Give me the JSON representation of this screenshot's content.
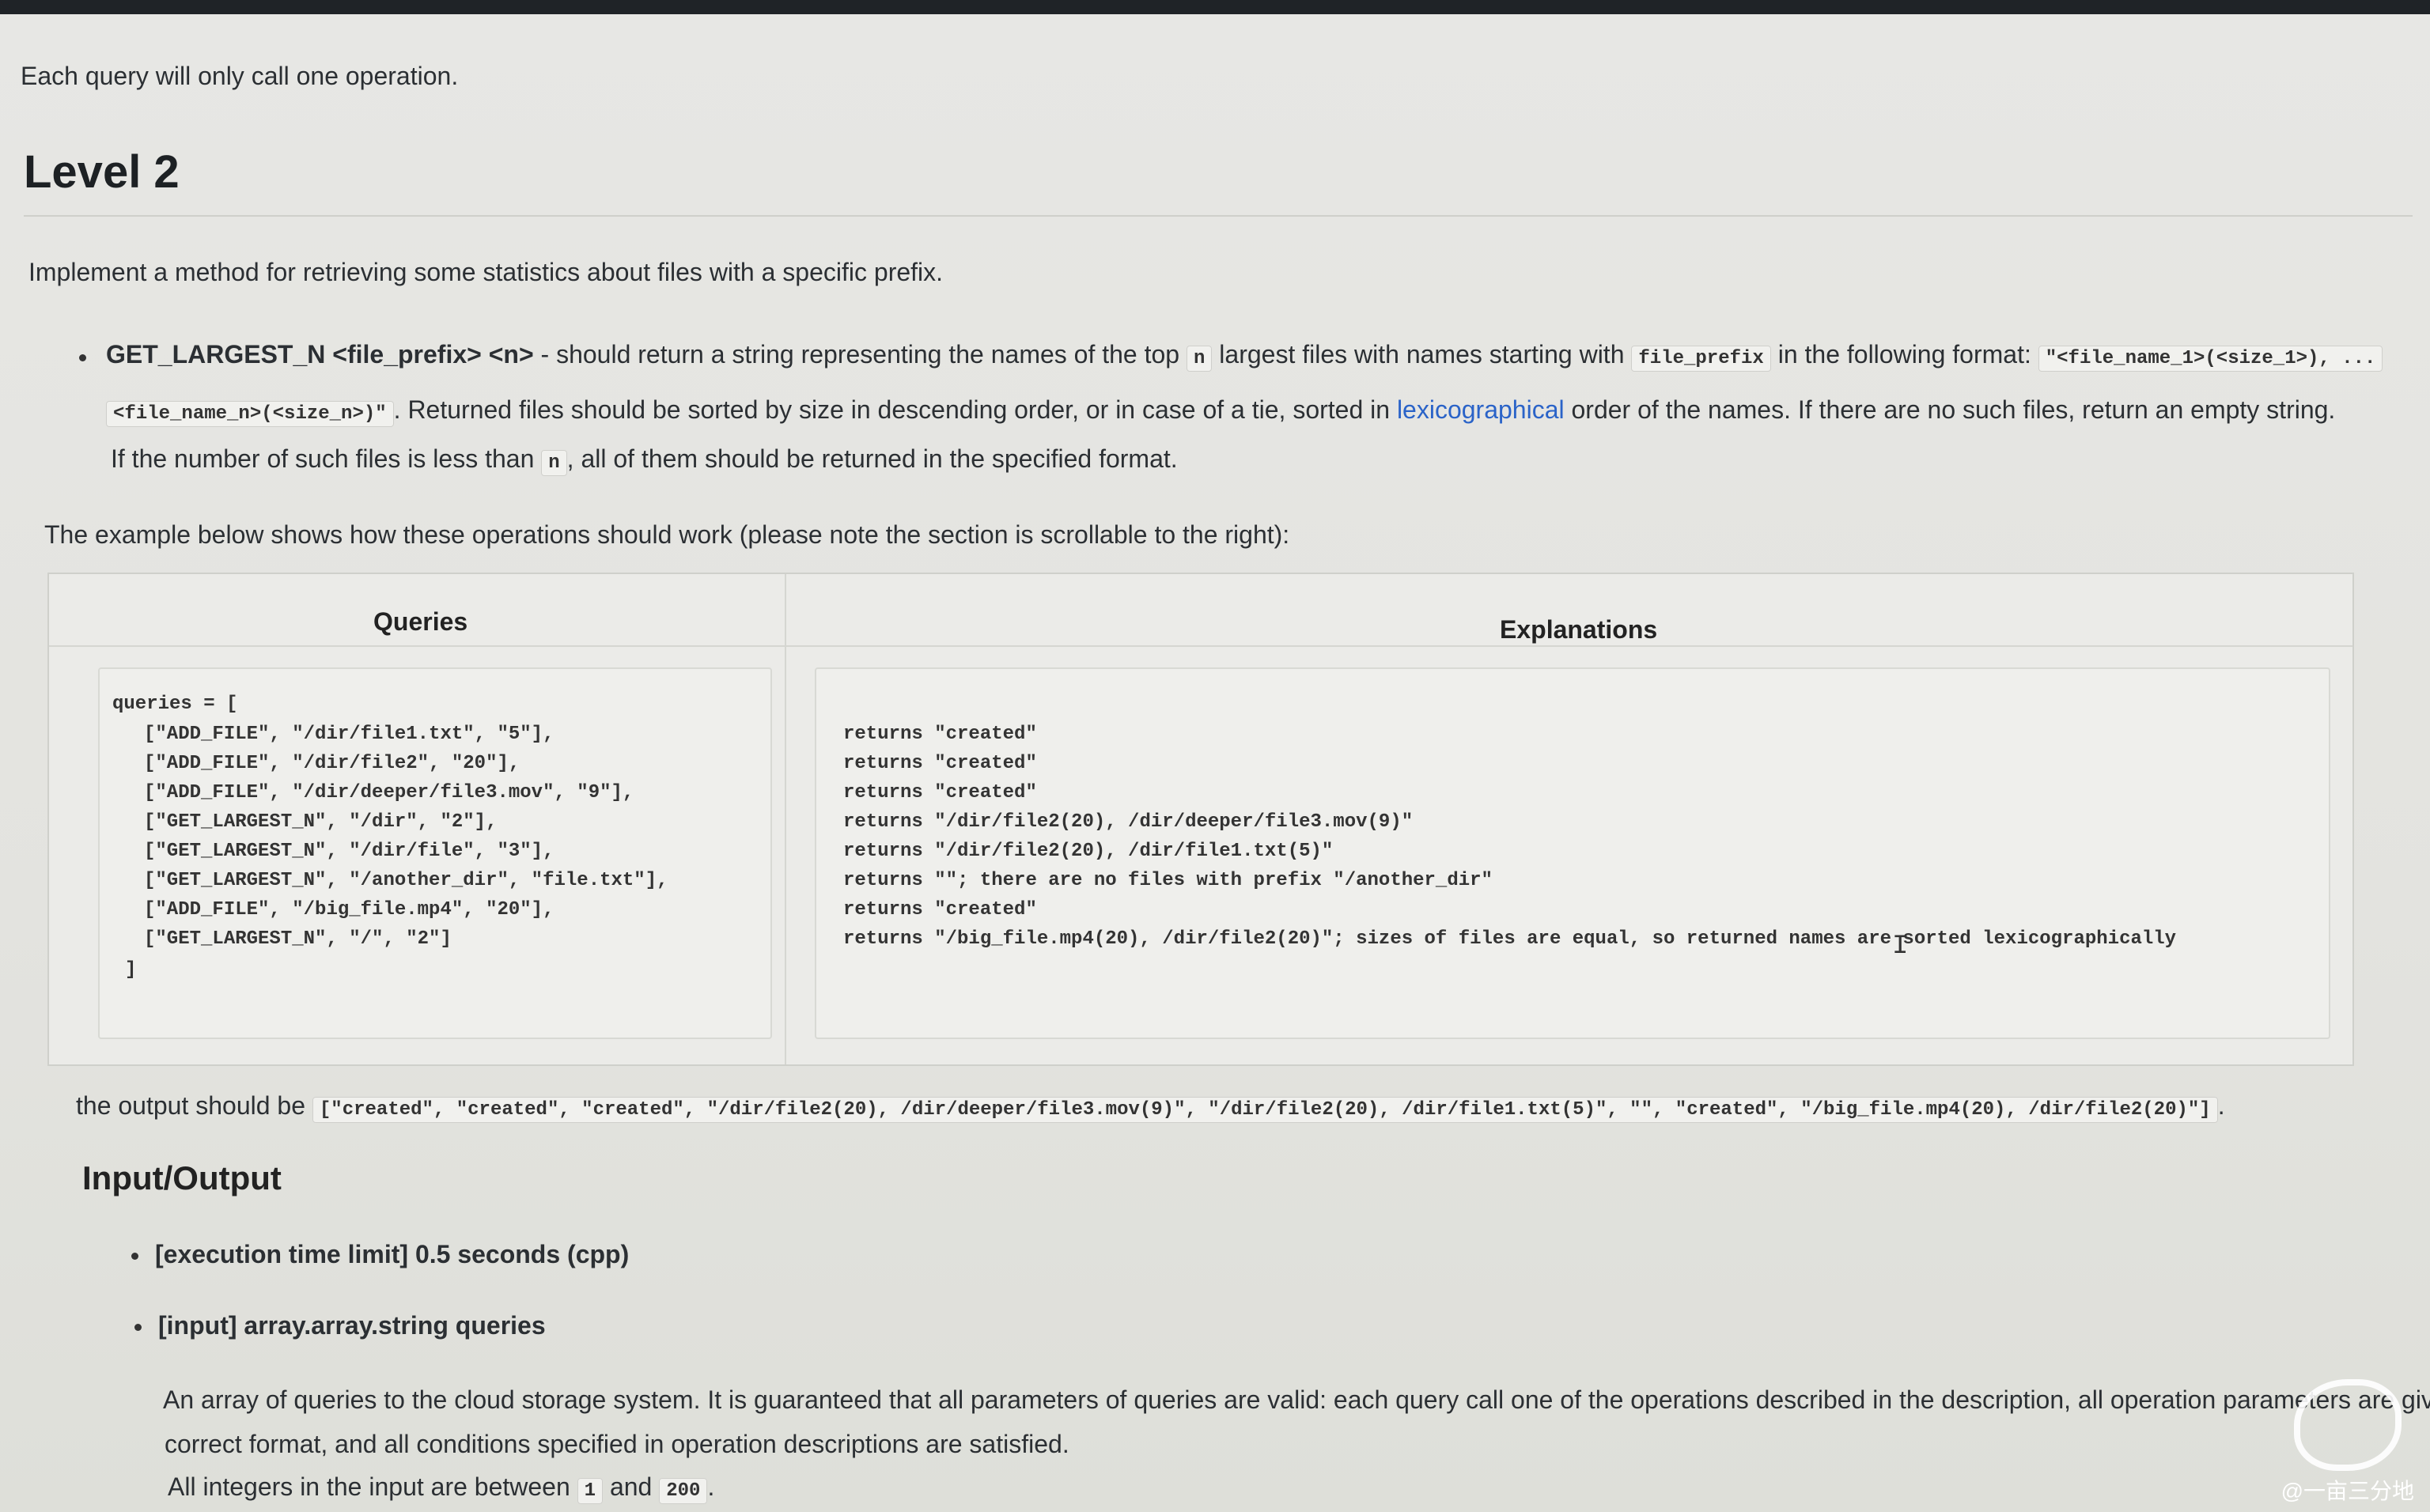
{
  "intro": {
    "note": "Each query will only call one operation."
  },
  "level2": {
    "title": "Level 2",
    "desc": "Implement a method for retrieving some statistics about files with a specific prefix.",
    "method": {
      "signature": "GET_LARGEST_N <file_prefix> <n>",
      "t1": " - should return a string representing the names of the top ",
      "c_n": "n",
      "t2": " largest files with names starting with ",
      "c_prefix": "file_prefix",
      "t3": " in the following format: ",
      "c_fmt1": "\"<file_name_1>(<size_1>), ...",
      "c_fmt2": "<file_name_n>(<size_n>)\"",
      "t4": ". Returned files should be sorted by size in descending order, or in case of a tie, sorted in ",
      "link": "lexicographical",
      "t5": " order of the names. If there are no such files, return an empty string.",
      "t6": "If the number of such files is less than ",
      "c_n2": "n",
      "t7": ", all of them should be returned in the specified format."
    },
    "example_intro": "The example below shows how these operations should work (please note the section is scrollable to the right):"
  },
  "table": {
    "headers": {
      "queries": "Queries",
      "explanations": "Explanations"
    },
    "queries_open": "queries = [",
    "queries": [
      "[\"ADD_FILE\", \"/dir/file1.txt\", \"5\"],",
      "[\"ADD_FILE\", \"/dir/file2\", \"20\"],",
      "[\"ADD_FILE\", \"/dir/deeper/file3.mov\", \"9\"],",
      "[\"GET_LARGEST_N\", \"/dir\", \"2\"],",
      "[\"GET_LARGEST_N\", \"/dir/file\", \"3\"],",
      "[\"GET_LARGEST_N\", \"/another_dir\", \"file.txt\"],",
      "[\"ADD_FILE\", \"/big_file.mp4\", \"20\"],",
      "[\"GET_LARGEST_N\", \"/\", \"2\"]"
    ],
    "queries_close": "]",
    "explanations": [
      "returns \"created\"",
      "returns \"created\"",
      "returns \"created\"",
      "returns \"/dir/file2(20), /dir/deeper/file3.mov(9)\"",
      "returns \"/dir/file2(20), /dir/file1.txt(5)\"",
      "returns \"\"; there are no files with prefix \"/another_dir\"",
      "returns \"created\"",
      "returns \"/big_file.mp4(20), /dir/file2(20)\"; sizes of files are equal, so returned names are sorted lexicographically"
    ]
  },
  "output": {
    "label": "the output should be ",
    "value": "[\"created\", \"created\", \"created\", \"/dir/file2(20), /dir/deeper/file3.mov(9)\", \"/dir/file2(20), /dir/file1.txt(5)\", \"\", \"created\", \"/big_file.mp4(20), /dir/file2(20)\"]",
    "end": "."
  },
  "io": {
    "title": "Input/Output",
    "time_limit": "[execution time limit] 0.5 seconds (cpp)",
    "input": "[input] array.array.string queries",
    "input_desc1": "An array of queries to the cloud storage system. It is guaranteed that all parameters of queries are valid: each query call one of the operations described in the description, all operation parameters are given in the",
    "input_desc2": "correct format, and all conditions specified in operation descriptions are satisfied.",
    "int_prefix": "All integers in the input are between ",
    "int_min": "1",
    "int_and": " and ",
    "int_max": "200",
    "int_end": "."
  },
  "watermark": "@一亩三分地"
}
